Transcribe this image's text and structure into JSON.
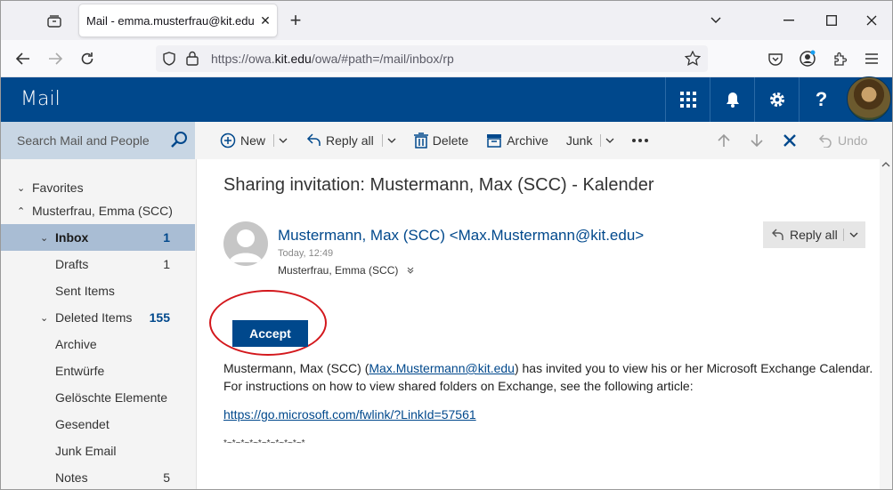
{
  "browser": {
    "tab_title": "Mail - emma.musterfrau@kit.edu",
    "tab_close": "✕",
    "new_tab": "+",
    "url_prefix": "https://owa.",
    "url_domain": "kit.edu",
    "url_suffix": "/owa/#path=/mail/inbox/rp"
  },
  "owa": {
    "title": "Mail"
  },
  "search": {
    "placeholder": "Search Mail and People"
  },
  "toolbar": {
    "new_label": "New",
    "reply_all_label": "Reply all",
    "delete_label": "Delete",
    "archive_label": "Archive",
    "junk_label": "Junk",
    "undo_label": "Undo"
  },
  "sidebar": {
    "favorites": "Favorites",
    "account": "Musterfrau, Emma (SCC)",
    "items": [
      {
        "label": "Inbox",
        "count": "1"
      },
      {
        "label": "Drafts",
        "count": "1"
      },
      {
        "label": "Sent Items",
        "count": ""
      },
      {
        "label": "Deleted Items",
        "count": "155"
      },
      {
        "label": "Archive",
        "count": ""
      },
      {
        "label": "Entwürfe",
        "count": ""
      },
      {
        "label": "Gelöschte Elemente",
        "count": ""
      },
      {
        "label": "Gesendet",
        "count": ""
      },
      {
        "label": "Junk Email",
        "count": ""
      },
      {
        "label": "Notes",
        "count": "5"
      }
    ]
  },
  "message": {
    "subject": "Sharing invitation: Mustermann, Max (SCC) - Kalender",
    "sender": "Mustermann, Max (SCC) <Max.Mustermann@kit.edu>",
    "time": "Today, 12:49",
    "to": "Musterfrau, Emma (SCC)",
    "reply_all": "Reply all",
    "accept": "Accept",
    "body_name": "Mustermann, Max (SCC) (",
    "body_email": "Max.Mustermann@kit.edu",
    "body_rest": ") has invited you to view his or her Microsoft Exchange Calendar. For instructions on how to view shared folders on Exchange, see the following article:",
    "link": "https://go.microsoft.com/fwlink/?LinkId=57561",
    "stars": "*~*~*~*~*~*~*~*~*~*"
  },
  "colors": {
    "owa_blue": "#00488c",
    "selected": "#a9bdd4",
    "annotation_red": "#d3171c"
  }
}
